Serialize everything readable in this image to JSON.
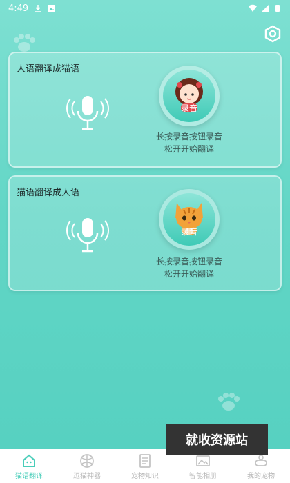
{
  "status_bar": {
    "time": "4:49"
  },
  "cards": [
    {
      "title": "人语翻译成猫语",
      "record_label": "录音",
      "avatar": "girl-avatar",
      "hint_line1": "长按录音按钮录音",
      "hint_line2": "松开开始翻译"
    },
    {
      "title": "猫语翻译成人语",
      "record_label": "录音",
      "avatar": "cat-avatar",
      "hint_line1": "长按录音按钮录音",
      "hint_line2": "松开开始翻译"
    }
  ],
  "watermark": "就收资源站",
  "tabs": [
    {
      "label": "猫语翻译",
      "icon": "cat-home-icon",
      "active": true
    },
    {
      "label": "逗猫神器",
      "icon": "ball-icon",
      "active": false
    },
    {
      "label": "宠物知识",
      "icon": "document-icon",
      "active": false
    },
    {
      "label": "智能相册",
      "icon": "photo-icon",
      "active": false
    },
    {
      "label": "我的宠物",
      "icon": "pet-icon",
      "active": false
    }
  ],
  "colors": {
    "accent": "#49cdb9",
    "background": "#62d6c6"
  }
}
